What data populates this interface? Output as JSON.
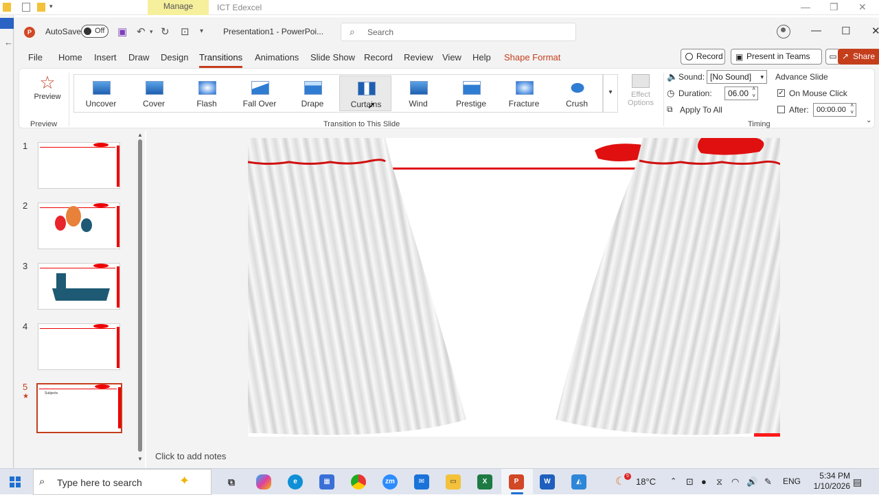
{
  "background_window": {
    "manage_tab": "Manage",
    "title": "ICT Edexcel"
  },
  "titlebar": {
    "autosave_label": "AutoSave",
    "autosave_state": "Off",
    "document_title": "Presentation1 - PowerPoi...",
    "search_placeholder": "Search"
  },
  "tabs": [
    "File",
    "Home",
    "Insert",
    "Draw",
    "Design",
    "Transitions",
    "Animations",
    "Slide Show",
    "Record",
    "Review",
    "View",
    "Help",
    "Shape Format"
  ],
  "tab_active": "Transitions",
  "header_buttons": {
    "record": "Record",
    "present_in_teams": "Present in Teams",
    "share": "Share"
  },
  "ribbon": {
    "preview": {
      "label": "Preview",
      "group": "Preview"
    },
    "transitions": [
      "Uncover",
      "Cover",
      "Flash",
      "Fall Over",
      "Drape",
      "Curtains",
      "Wind",
      "Prestige",
      "Fracture",
      "Crush"
    ],
    "selected_transition": "Curtains",
    "group_label": "Transition to This Slide",
    "effect_options": {
      "line1": "Effect",
      "line2": "Options"
    },
    "timing": {
      "sound_label": "Sound:",
      "sound_value": "[No Sound]",
      "duration_label": "Duration:",
      "duration_value": "06.00",
      "apply_label": "Apply To All",
      "advance_label": "Advance Slide",
      "on_mouse_click": "On Mouse Click",
      "on_mouse_click_checked": true,
      "after_label": "After:",
      "after_value": "00:00.00",
      "after_checked": false,
      "group": "Timing"
    }
  },
  "slides": [
    {
      "number": "1"
    },
    {
      "number": "2"
    },
    {
      "number": "3"
    },
    {
      "number": "4"
    },
    {
      "number": "5",
      "active": true,
      "title": "Subjects"
    }
  ],
  "notes_placeholder": "Click to add notes",
  "taskbar": {
    "search_placeholder": "Type here to search",
    "weather_badge": "5",
    "temperature": "18°C",
    "language": "ENG",
    "time": "5:34 PM",
    "date": "1/10/2026"
  },
  "colors": {
    "accent": "#c43e1c",
    "slide_red": "#e01010",
    "ribbon_bg": "#f3f3f3"
  }
}
